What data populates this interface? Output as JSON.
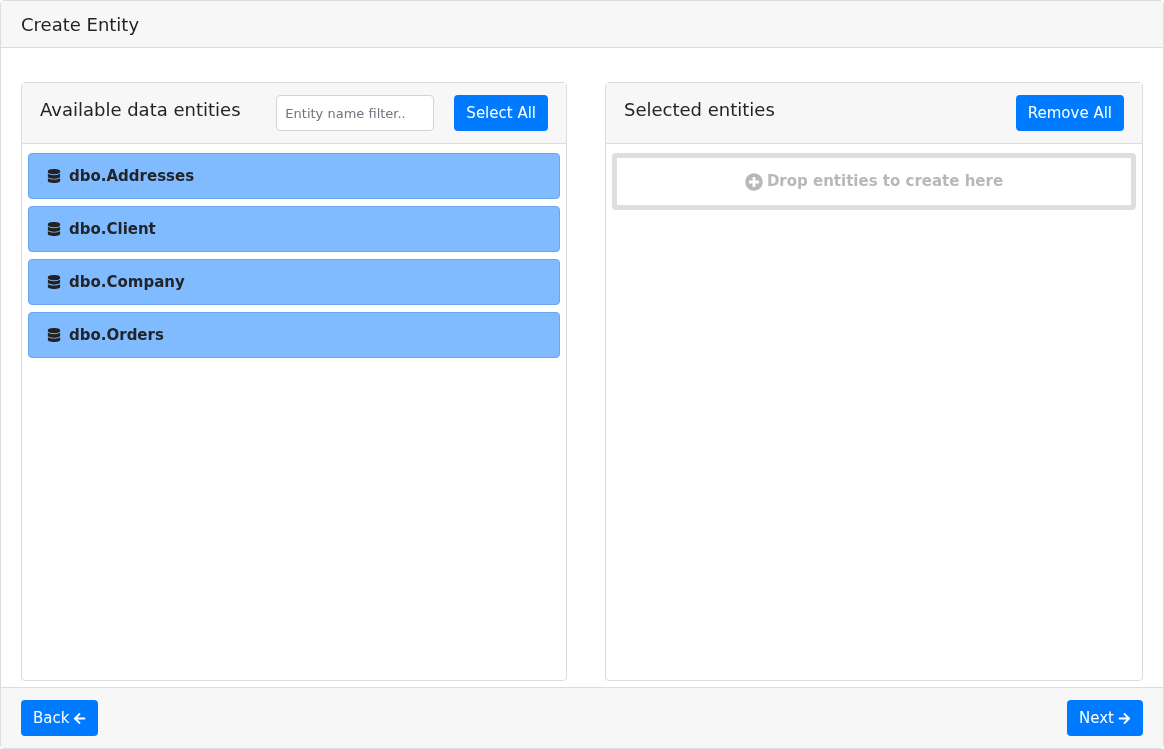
{
  "window": {
    "title": "Create Entity"
  },
  "available": {
    "title": "Available data entities",
    "filter": {
      "placeholder": "Entity name filter.."
    },
    "select_all": "Select All",
    "items": [
      {
        "label": "dbo.Addresses"
      },
      {
        "label": "dbo.Client"
      },
      {
        "label": "dbo.Company"
      },
      {
        "label": "dbo.Orders"
      }
    ]
  },
  "selected": {
    "title": "Selected entities",
    "remove_all": "Remove All",
    "drop_hint": "Drop entities to create here"
  },
  "footer": {
    "back": "Back",
    "next": "Next"
  }
}
